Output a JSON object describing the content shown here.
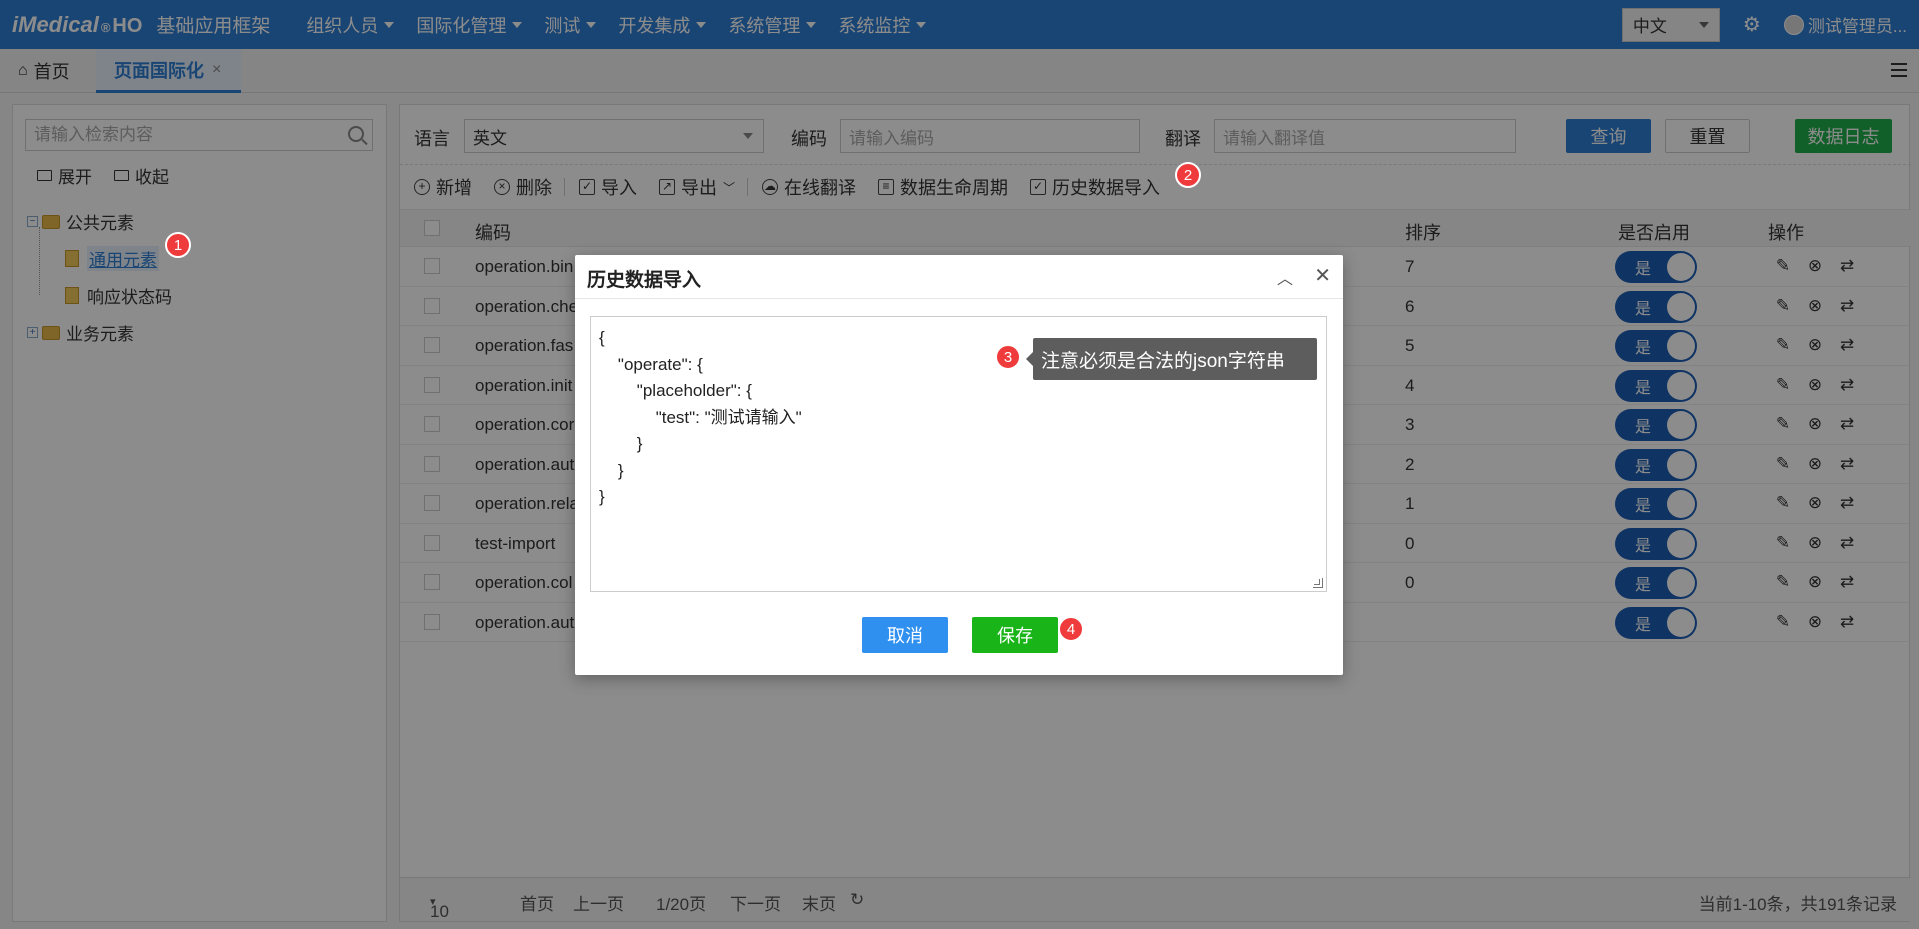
{
  "header": {
    "logo": "iMedical",
    "logo_reg": "®",
    "logo_ho": "HO",
    "framework": "基础应用框架",
    "menu": [
      "组织人员",
      "国际化管理",
      "测试",
      "开发集成",
      "系统管理",
      "系统监控"
    ],
    "language": "中文",
    "user": "测试管理员..."
  },
  "tabs": {
    "home": "首页",
    "active": "页面国际化",
    "close": "×"
  },
  "tree": {
    "search_placeholder": "请输入检索内容",
    "expand": "展开",
    "collapse": "收起",
    "nodes": {
      "public": "公共元素",
      "common": "通用元素",
      "status": "响应状态码",
      "business": "业务元素"
    }
  },
  "filters": {
    "language_label": "语言",
    "language_value": "英文",
    "code_label": "编码",
    "code_placeholder": "请输入编码",
    "translation_label": "翻译",
    "translation_placeholder": "请输入翻译值",
    "query": "查询",
    "reset": "重置",
    "data_log": "数据日志"
  },
  "toolbar": {
    "add": "新增",
    "delete": "删除",
    "import": "导入",
    "export": "导出",
    "online_translate": "在线翻译",
    "lifecycle": "数据生命周期",
    "history_import": "历史数据导入"
  },
  "table": {
    "columns": {
      "code": "编码",
      "sort": "排序",
      "enabled": "是否启用",
      "actions": "操作"
    },
    "toggle_label": "是",
    "rows": [
      {
        "code": "operation.bin",
        "sort": "7"
      },
      {
        "code": "operation.che",
        "sort": "6"
      },
      {
        "code": "operation.fas",
        "sort": "5"
      },
      {
        "code": "operation.init",
        "sort": "4"
      },
      {
        "code": "operation.cor",
        "sort": "3"
      },
      {
        "code": "operation.aut",
        "sort": "2"
      },
      {
        "code": "operation.rela",
        "sort": "1"
      },
      {
        "code": "test-import",
        "sort": "0"
      },
      {
        "code": "operation.col",
        "sort": "0"
      },
      {
        "code": "operation.aut",
        "sort": ""
      }
    ]
  },
  "pagination": {
    "page_size": "10",
    "first": "首页",
    "prev": "上一页",
    "page_info": "1/20页",
    "next": "下一页",
    "last": "末页",
    "summary": "当前1-10条，共191条记录"
  },
  "dialog": {
    "title": "历史数据导入",
    "json_text": "{\n\t\"operate\": {\n\t\t\"placeholder\": {\n\t\t\t\"test\": \"测试请输入\"\n\t\t}\n\t}\n}",
    "cancel": "取消",
    "save": "保存"
  },
  "tooltip": "注意必须是合法的json字符串",
  "badges": [
    "1",
    "2",
    "3",
    "4"
  ],
  "colors": {
    "primary": "#2f7ed3",
    "success": "#21b04b",
    "save_green": "#18b418",
    "badge_red": "#ef3b3b",
    "toggle_on": "#1c5fb5"
  }
}
